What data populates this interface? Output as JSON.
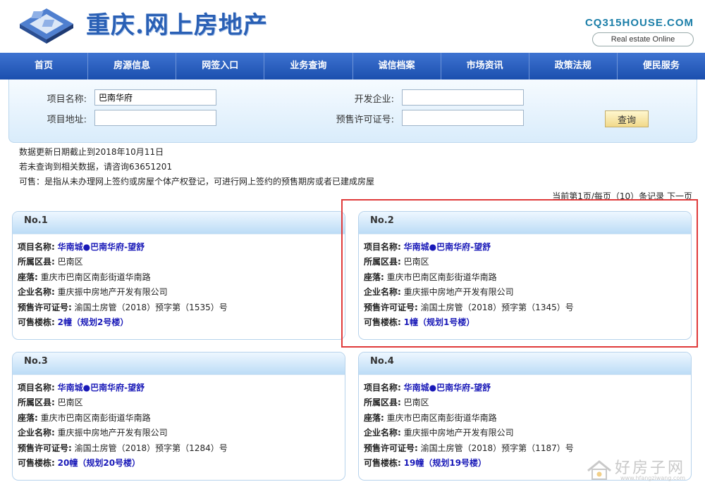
{
  "header": {
    "site_title": "重庆.网上房地产",
    "brand": "CQ315HOUSE.COM",
    "brand_sub": "Real estate Online"
  },
  "nav": [
    "首页",
    "房源信息",
    "网签入口",
    "业务查询",
    "诚信档案",
    "市场资讯",
    "政策法规",
    "便民服务"
  ],
  "search": {
    "project_name_label": "项目名称:",
    "project_name_value": "巴南华府",
    "developer_label": "开发企业:",
    "developer_value": "",
    "address_label": "项目地址:",
    "address_value": "",
    "permit_label": "预售许可证号:",
    "permit_value": "",
    "query_button": "查询"
  },
  "notes": {
    "update": "数据更新日期截止到2018年10月11日",
    "contact": "若未查询到相关数据，请咨询63651201",
    "definition": "可售：是指从未办理网上签约或房屋个体产权登记，可进行网上签约的预售期房或者已建成房屋"
  },
  "pager": "当前第1页/每页（10）条记录 下一页",
  "labels": {
    "name": "项目名称:",
    "district": "所属区县:",
    "location": "座落:",
    "company": "企业名称:",
    "permit": "预售许可证号:",
    "buildings": "可售楼栋:"
  },
  "cards": [
    {
      "no": "No.1",
      "name": "华南城●巴南华府-望舒",
      "district": "巴南区",
      "location": "重庆市巴南区南彭街道华南路",
      "company": "重庆振中房地产开发有限公司",
      "permit": "渝国土房管（2018）预字第（1535）号",
      "buildings": "2幢（规划2号楼）"
    },
    {
      "no": "No.2",
      "name": "华南城●巴南华府-望舒",
      "district": "巴南区",
      "location": "重庆市巴南区南彭街道华南路",
      "company": "重庆振中房地产开发有限公司",
      "permit": "渝国土房管（2018）预字第（1345）号",
      "buildings": "1幢（规划1号楼）"
    },
    {
      "no": "No.3",
      "name": "华南城●巴南华府-望舒",
      "district": "巴南区",
      "location": "重庆市巴南区南彭街道华南路",
      "company": "重庆振中房地产开发有限公司",
      "permit": "渝国土房管（2018）预字第（1284）号",
      "buildings": "20幢（规划20号楼）"
    },
    {
      "no": "No.4",
      "name": "华南城●巴南华府-望舒",
      "district": "巴南区",
      "location": "重庆市巴南区南彭街道华南路",
      "company": "重庆振中房地产开发有限公司",
      "permit": "渝国土房管（2018）预字第（1187）号",
      "buildings": "19幢（规划19号楼）"
    }
  ],
  "watermark": {
    "text": "好房子网",
    "url": "www.hfangziwang.com"
  }
}
